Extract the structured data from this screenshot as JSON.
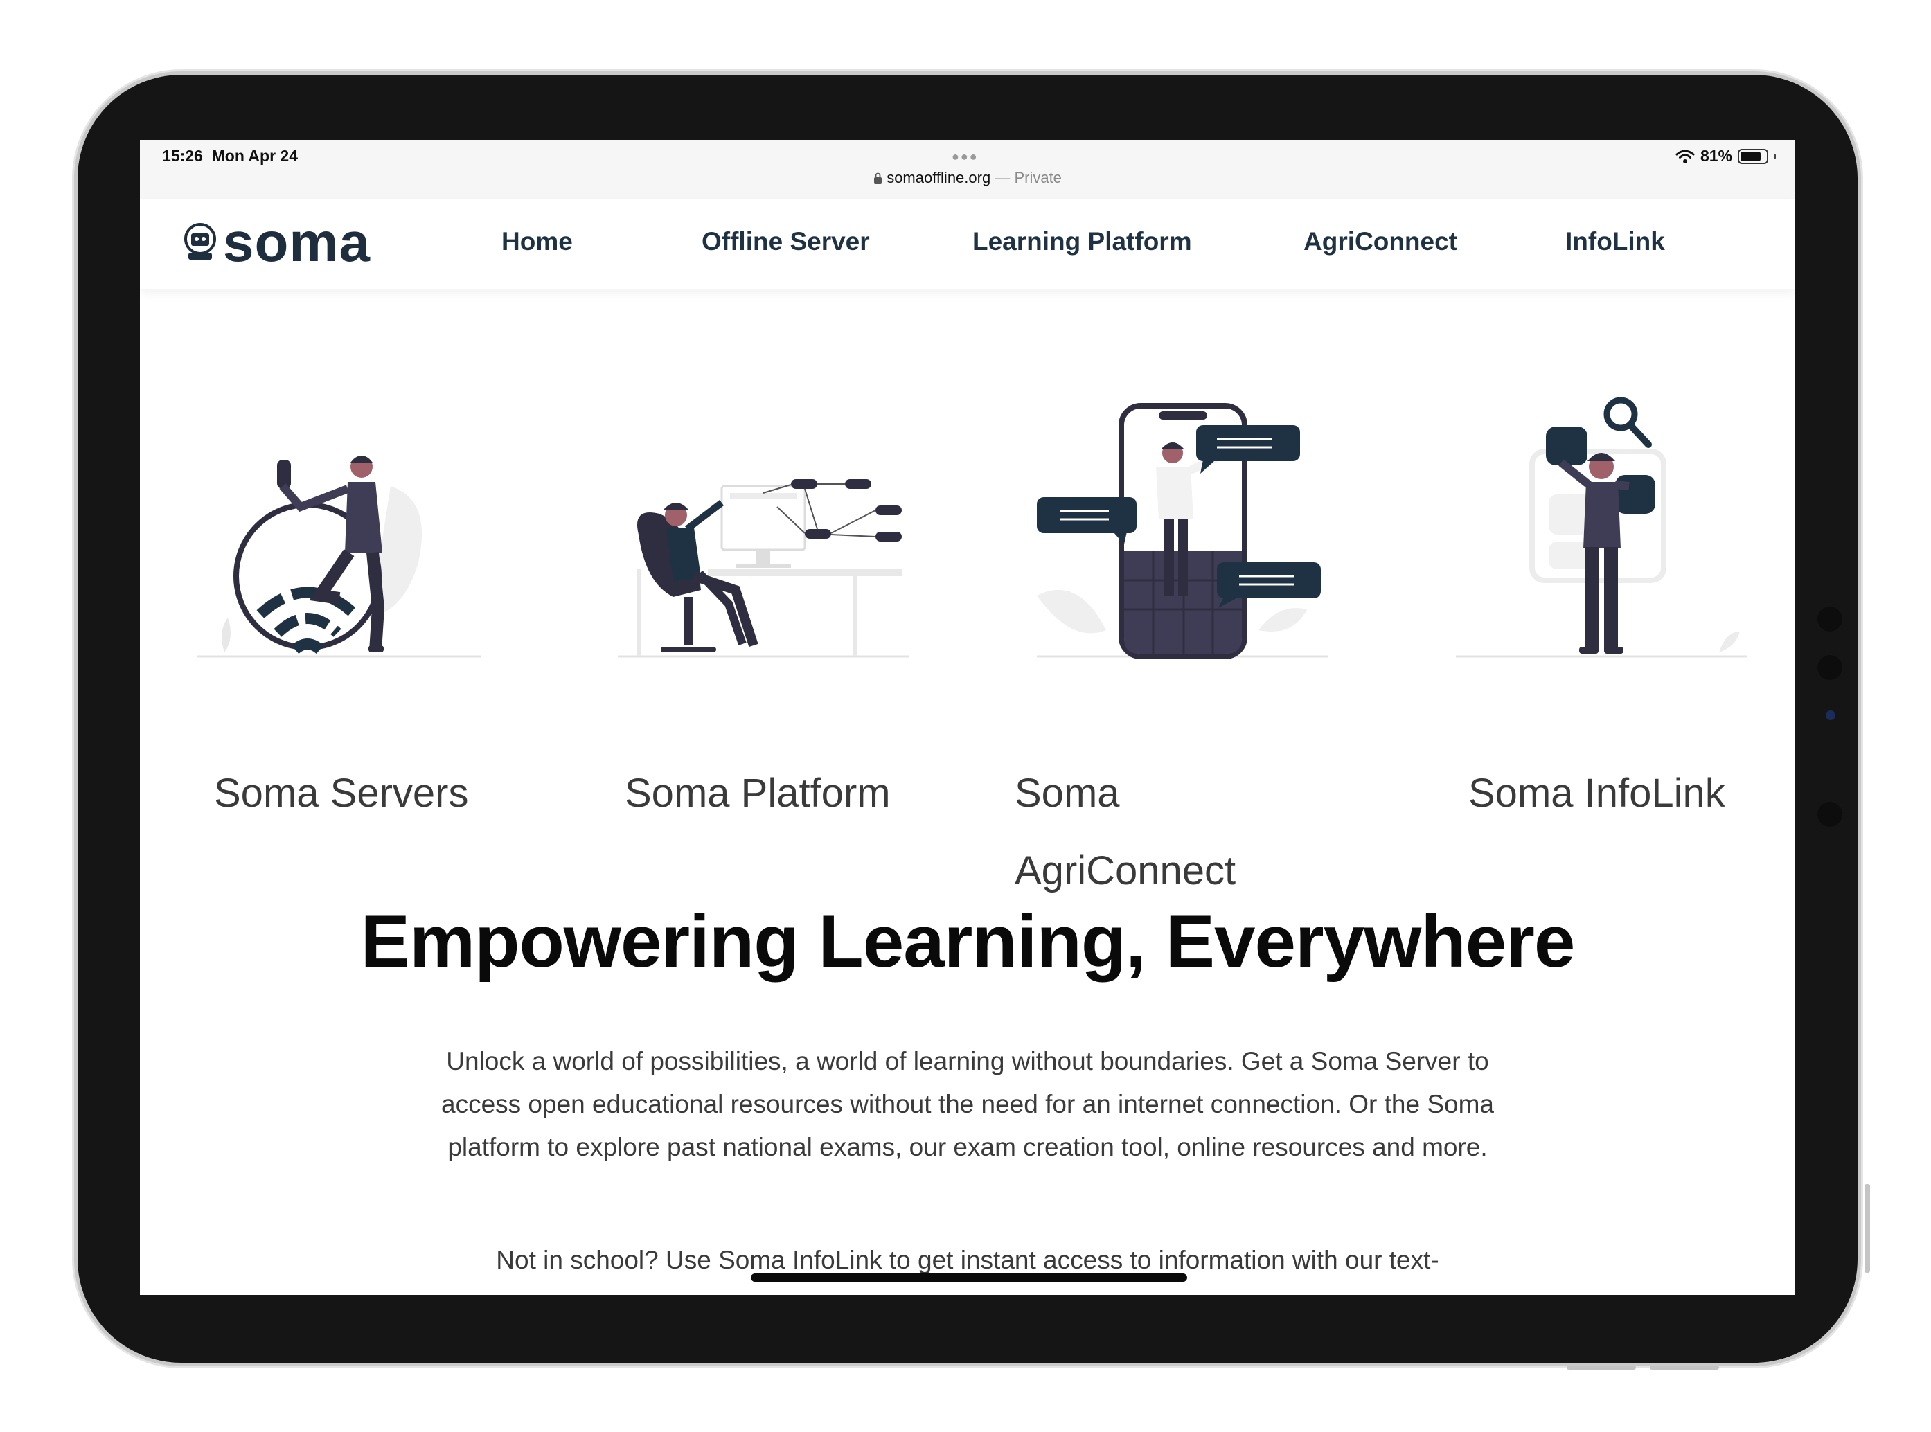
{
  "status_bar": {
    "time": "15:26",
    "date": "Mon Apr 24",
    "url": "somaoffline.org",
    "private_label": "— Private",
    "battery": "81%",
    "battery_level": 0.81
  },
  "header": {
    "logo_text": "soma",
    "nav": [
      {
        "label": "Home"
      },
      {
        "label": "Offline Server"
      },
      {
        "label": "Learning Platform"
      },
      {
        "label": "AgriConnect"
      },
      {
        "label": "InfoLink"
      }
    ]
  },
  "cards": [
    {
      "title": "Soma Servers",
      "icon": "wifi-person-illustration"
    },
    {
      "title": "Soma Platform",
      "icon": "desk-diagram-illustration"
    },
    {
      "title_line1": "Soma",
      "title_line2": "AgriConnect",
      "icon": "phone-chat-illustration"
    },
    {
      "title": "Soma InfoLink",
      "icon": "search-person-illustration"
    }
  ],
  "hero": {
    "title": "Empowering Learning, Everywhere",
    "paragraph1": "Unlock a world of possibilities, a world of learning without boundaries. Get a Soma Server to access open educational resources without the need for an internet connection. Or the Soma platform to explore past national exams, our exam creation tool, online resources and more.",
    "paragraph2": "Not in school? Use Soma InfoLink to get instant access to information with our text-"
  },
  "colors": {
    "brand_dark": "#1f2e3e",
    "illustration_dark": "#2f2e41",
    "illustration_accent": "#1f3244"
  }
}
